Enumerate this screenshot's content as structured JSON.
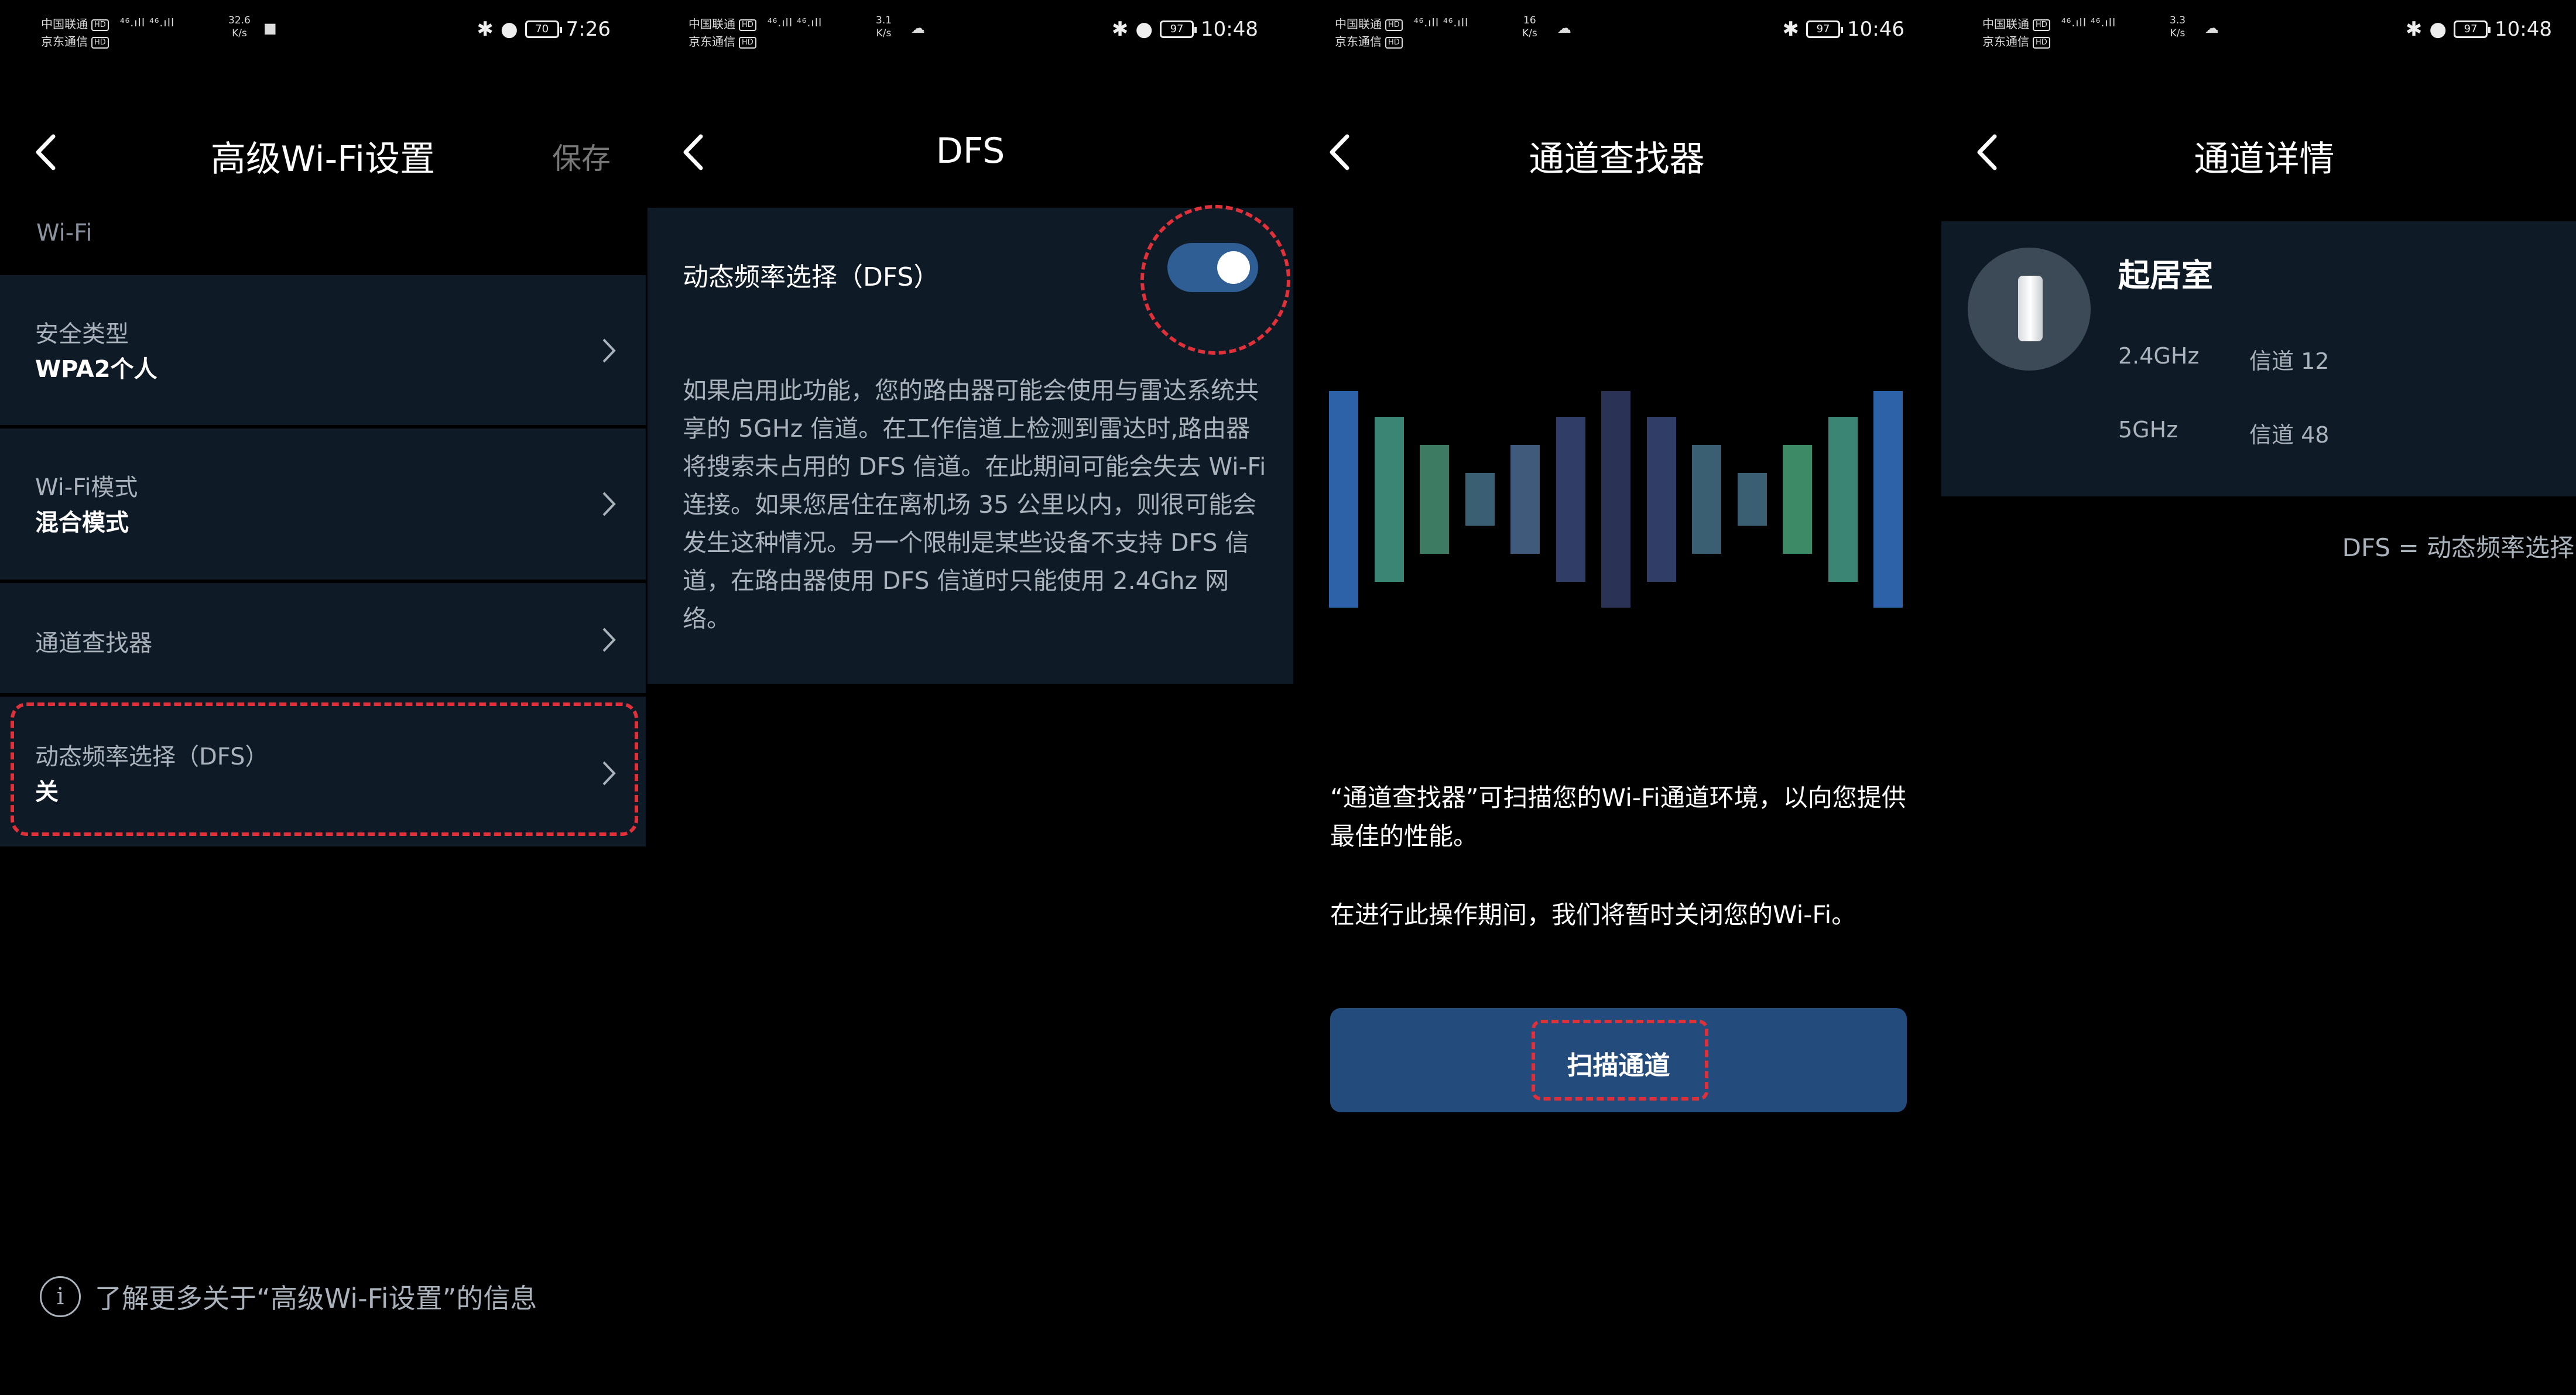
{
  "colors": {
    "background": "#000000",
    "panel": "#0e1a25",
    "accent": "#234c7c",
    "toggle_on": "#2e5e93",
    "highlight_dash": "#e0303a",
    "muted_text": "#aab2bc"
  },
  "screens": [
    {
      "status": {
        "carrier1": "中国联通",
        "carrier2": "京东通信",
        "hd": "HD",
        "net": "⁴⁶.ıll ⁴⁶.ıll",
        "speed1": "32.6",
        "speed2": "K/s",
        "time": "7:26",
        "battery": "70"
      },
      "header": {
        "title": "高级Wi-Fi设置",
        "save": "保存"
      },
      "section_label": "Wi-Fi",
      "rows": [
        {
          "label": "安全类型",
          "value": "WPA2个人"
        },
        {
          "label": "Wi-Fi模式",
          "value": "混合模式"
        },
        {
          "label": "通道查找器",
          "value": ""
        },
        {
          "label": "动态频率选择（DFS）",
          "value": "关"
        }
      ],
      "info_text": "了解更多关于“高级Wi-Fi设置”的信息"
    },
    {
      "status": {
        "carrier1": "中国联通",
        "carrier2": "京东通信",
        "hd": "HD",
        "net": "⁴⁶.ıll ⁴⁶.ıll",
        "speed1": "3.1",
        "speed2": "K/s",
        "time": "10:48",
        "battery": "97"
      },
      "header": {
        "title": "DFS"
      },
      "toggle_label": "动态频率选择（DFS）",
      "toggle_state": "on",
      "description": "如果启用此功能，您的路由器可能会使用与雷达系统共享的 5GHz 信道。在工作信道上检测到雷达时,路由器将搜索未占用的 DFS 信道。在此期间可能会失去 Wi-Fi 连接。如果您居住在离机场 35 公里以内，则很可能会发生这种情况。另一个限制是某些设备不支持 DFS 信道，在路由器使用 DFS 信道时只能使用 2.4Ghz 网络。"
    },
    {
      "status": {
        "carrier1": "中国联通",
        "carrier2": "京东通信",
        "hd": "HD",
        "net": "⁴⁶.ıll ⁴⁶.ıll",
        "speed1": "16",
        "speed2": "K/s",
        "time": "10:46",
        "battery": "97"
      },
      "header": {
        "title": "通道查找器"
      },
      "text1": "“通道查找器”可扫描您的Wi-Fi通道环境，以向您提供最佳的性能。",
      "text2": "在进行此操作期间，我们将暂时关闭您的Wi-Fi。",
      "scan_button": "扫描通道"
    },
    {
      "status": {
        "carrier1": "中国联通",
        "carrier2": "京东通信",
        "hd": "HD",
        "net": "⁴⁶.ıll ⁴⁶.ıll",
        "speed1": "3.3",
        "speed2": "K/s",
        "time": "10:48",
        "battery": "97"
      },
      "header": {
        "title": "通道详情"
      },
      "room": "起居室",
      "bands": [
        {
          "band": "2.4GHz",
          "channel": "信道 12"
        },
        {
          "band": "5GHz",
          "channel": "信道 48"
        }
      ],
      "legend": "DFS = 动态频率选择"
    }
  ]
}
